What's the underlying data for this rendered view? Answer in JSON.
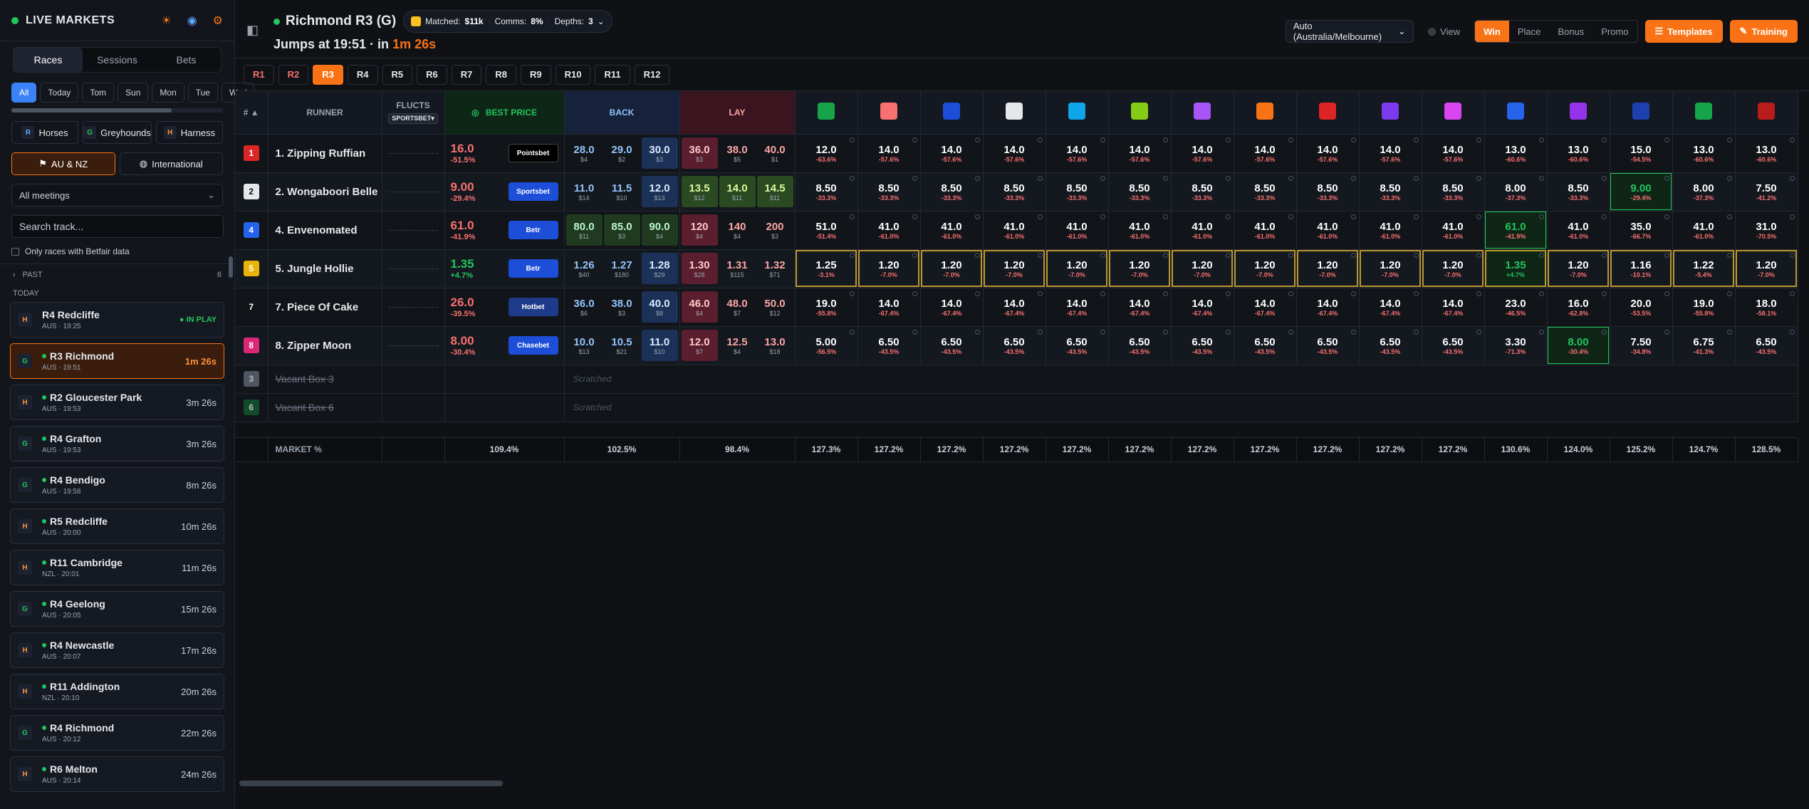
{
  "sidebar": {
    "title": "LIVE MARKETS",
    "tabs": [
      {
        "label": "Races",
        "active": true
      },
      {
        "label": "Sessions"
      },
      {
        "label": "Bets"
      }
    ],
    "days": [
      {
        "label": "All",
        "active": true
      },
      {
        "label": "Today"
      },
      {
        "label": "Tom"
      },
      {
        "label": "Sun"
      },
      {
        "label": "Mon"
      },
      {
        "label": "Tue"
      },
      {
        "label": "Wed"
      }
    ],
    "types": [
      {
        "badge": "R",
        "label": "Horses"
      },
      {
        "badge": "G",
        "label": "Greyhounds"
      },
      {
        "badge": "H",
        "label": "Harness"
      }
    ],
    "regions": [
      {
        "label": "AU & NZ",
        "active": true
      },
      {
        "label": "International"
      }
    ],
    "meetings_select": "All meetings",
    "search_placeholder": "Search track...",
    "betfair_filter": "Only races with Betfair data",
    "past": {
      "label": "PAST",
      "count": "6"
    },
    "today_label": "TODAY",
    "races": [
      {
        "badge": "H",
        "name": "R4 Redcliffe",
        "sub": "AUS · 19:25",
        "time": "● IN PLAY",
        "state": "inplay",
        "dot": false
      },
      {
        "badge": "G",
        "name": "R3 Richmond",
        "sub": "AUS · 19:51",
        "time": "1m 26s",
        "state": "active",
        "dot": true
      },
      {
        "badge": "H",
        "name": "R2 Gloucester Park",
        "sub": "AUS · 19:53",
        "time": "3m 26s",
        "dot": true
      },
      {
        "badge": "G",
        "name": "R4 Grafton",
        "sub": "AUS · 19:53",
        "time": "3m 26s",
        "dot": true
      },
      {
        "badge": "G",
        "name": "R4 Bendigo",
        "sub": "AUS · 19:58",
        "time": "8m 26s",
        "dot": true
      },
      {
        "badge": "H",
        "name": "R5 Redcliffe",
        "sub": "AUS · 20:00",
        "time": "10m 26s",
        "dot": true
      },
      {
        "badge": "H",
        "name": "R11 Cambridge",
        "sub": "NZL · 20:01",
        "time": "11m 26s",
        "dot": true
      },
      {
        "badge": "G",
        "name": "R4 Geelong",
        "sub": "AUS · 20:05",
        "time": "15m 26s",
        "dot": true
      },
      {
        "badge": "H",
        "name": "R4 Newcastle",
        "sub": "AUS · 20:07",
        "time": "17m 26s",
        "dot": true
      },
      {
        "badge": "H",
        "name": "R11 Addington",
        "sub": "NZL · 20:10",
        "time": "20m 26s",
        "dot": true
      },
      {
        "badge": "G",
        "name": "R4 Richmond",
        "sub": "AUS · 20:12",
        "time": "22m 26s",
        "dot": true
      },
      {
        "badge": "H",
        "name": "R6 Melton",
        "sub": "AUS · 20:14",
        "time": "24m 26s",
        "dot": true
      }
    ]
  },
  "header": {
    "title": "Richmond R3 (G)",
    "matched_label": "Matched:",
    "matched": "$11k",
    "comms_label": "Comms:",
    "comms": "8%",
    "depths_label": "Depths:",
    "depths": "3",
    "jumps_prefix": "Jumps at 19:51 · in ",
    "countdown": "1m 26s",
    "timezone": "Auto (Australia/Melbourne)",
    "view_label": "View",
    "markets": [
      {
        "label": "Win",
        "active": true
      },
      {
        "label": "Place"
      },
      {
        "label": "Bonus"
      },
      {
        "label": "Promo"
      }
    ],
    "templates_label": "Templates",
    "training_label": "Training"
  },
  "race_tabs": [
    {
      "label": "R1",
      "state": "done"
    },
    {
      "label": "R2",
      "state": "done"
    },
    {
      "label": "R3",
      "state": "active"
    },
    {
      "label": "R4"
    },
    {
      "label": "R5"
    },
    {
      "label": "R6"
    },
    {
      "label": "R7"
    },
    {
      "label": "R8"
    },
    {
      "label": "R9"
    },
    {
      "label": "R10"
    },
    {
      "label": "R11"
    },
    {
      "label": "R12"
    }
  ],
  "table": {
    "h_num": "# ▲",
    "h_runner": "RUNNER",
    "h_flucts": "FLUCTS",
    "h_flucts_sel": "SPORTSBET▾",
    "h_best": "BEST PRICE",
    "h_back": "BACK",
    "h_lay": "LAY",
    "bookies": [
      {
        "name": "tab",
        "color": "#16a34a"
      },
      {
        "name": "bookie-2",
        "color": "#f87171"
      },
      {
        "name": "bookie-3",
        "color": "#1d4ed8"
      },
      {
        "name": "bookie-4",
        "color": "#e5e7eb"
      },
      {
        "name": "bookie-5",
        "color": "#0ea5e9"
      },
      {
        "name": "bookie-6",
        "color": "#84cc16"
      },
      {
        "name": "bookie-7",
        "color": "#a855f7"
      },
      {
        "name": "bookie-8",
        "color": "#f97316"
      },
      {
        "name": "bookie-9",
        "color": "#dc2626"
      },
      {
        "name": "bookie-10",
        "color": "#7c3aed"
      },
      {
        "name": "bookie-11",
        "color": "#d946ef"
      },
      {
        "name": "bookie-12",
        "color": "#2563eb"
      },
      {
        "name": "bookie-13",
        "color": "#9333ea"
      },
      {
        "name": "bookie-14",
        "color": "#1e40af"
      },
      {
        "name": "bookie-15",
        "color": "#16a34a"
      },
      {
        "name": "bookie-16",
        "color": "#b91c1c"
      }
    ],
    "runners": [
      {
        "num": "1",
        "numColor": "#dc2626",
        "name": "1. Zipping Ruffian",
        "bp": "16.0",
        "bpPct": "-51.5%",
        "bpUp": false,
        "bpBook": "Pointsbet",
        "bpBookColor": "#000",
        "back": [
          [
            "28.0",
            "$4"
          ],
          [
            "29.0",
            "$2"
          ],
          [
            "30.0",
            "$3"
          ]
        ],
        "lay": [
          [
            "36.0",
            "$3"
          ],
          [
            "38.0",
            "$5"
          ],
          [
            "40.0",
            "$1"
          ]
        ],
        "odds": [
          [
            "12.0",
            "-63.6%"
          ],
          [
            "14.0",
            "-57.6%"
          ],
          [
            "14.0",
            "-57.6%"
          ],
          [
            "14.0",
            "-57.6%"
          ],
          [
            "14.0",
            "-57.6%"
          ],
          [
            "14.0",
            "-57.6%"
          ],
          [
            "14.0",
            "-57.6%"
          ],
          [
            "14.0",
            "-57.6%"
          ],
          [
            "14.0",
            "-57.6%"
          ],
          [
            "14.0",
            "-57.6%"
          ],
          [
            "14.0",
            "-57.6%"
          ],
          [
            "13.0",
            "-60.6%"
          ],
          [
            "13.0",
            "-60.6%"
          ],
          [
            "15.0",
            "-54.5%"
          ],
          [
            "13.0",
            "-60.6%"
          ],
          [
            "13.0",
            "-60.6%"
          ]
        ]
      },
      {
        "num": "2",
        "numColor": "#e5e7eb",
        "name": "2. Wongaboori Belle",
        "bp": "9.00",
        "bpPct": "-29.4%",
        "bpUp": false,
        "bpBook": "Sportsbet",
        "bpBookColor": "#1d4ed8",
        "back": [
          [
            "11.0",
            "$14"
          ],
          [
            "11.5",
            "$10"
          ],
          [
            "12.0",
            "$13"
          ]
        ],
        "lay": [
          [
            "13.5",
            "$12"
          ],
          [
            "14.0",
            "$11"
          ],
          [
            "14.5",
            "$11"
          ]
        ],
        "layGreen": true,
        "odds": [
          [
            "8.50",
            "-33.3%"
          ],
          [
            "8.50",
            "-33.3%"
          ],
          [
            "8.50",
            "-33.3%"
          ],
          [
            "8.50",
            "-33.3%"
          ],
          [
            "8.50",
            "-33.3%"
          ],
          [
            "8.50",
            "-33.3%"
          ],
          [
            "8.50",
            "-33.3%"
          ],
          [
            "8.50",
            "-33.3%"
          ],
          [
            "8.50",
            "-33.3%"
          ],
          [
            "8.50",
            "-33.3%"
          ],
          [
            "8.50",
            "-33.3%"
          ],
          [
            "8.00",
            "-37.3%"
          ],
          [
            "8.50",
            "-33.3%"
          ],
          [
            "9.00",
            "-29.4%",
            "best"
          ],
          [
            "8.00",
            "-37.3%"
          ],
          [
            "7.50",
            "-41.2%"
          ]
        ]
      },
      {
        "num": "4",
        "numColor": "#2563eb",
        "name": "4. Envenomated",
        "bp": "61.0",
        "bpPct": "-41.9%",
        "bpUp": false,
        "bpBook": "Betr",
        "bpBookColor": "#1d4ed8",
        "back": [
          [
            "80.0",
            "$11"
          ],
          [
            "85.0",
            "$3"
          ],
          [
            "90.0",
            "$4"
          ]
        ],
        "backGreen": true,
        "lay": [
          [
            "120",
            "$4"
          ],
          [
            "140",
            "$4"
          ],
          [
            "200",
            "$3"
          ]
        ],
        "odds": [
          [
            "51.0",
            "-51.4%"
          ],
          [
            "41.0",
            "-61.0%"
          ],
          [
            "41.0",
            "-61.0%"
          ],
          [
            "41.0",
            "-61.0%"
          ],
          [
            "41.0",
            "-61.0%"
          ],
          [
            "41.0",
            "-61.0%"
          ],
          [
            "41.0",
            "-61.0%"
          ],
          [
            "41.0",
            "-61.0%"
          ],
          [
            "41.0",
            "-61.0%"
          ],
          [
            "41.0",
            "-61.0%"
          ],
          [
            "41.0",
            "-61.0%"
          ],
          [
            "61.0",
            "-41.9%",
            "best"
          ],
          [
            "41.0",
            "-61.0%"
          ],
          [
            "35.0",
            "-66.7%"
          ],
          [
            "41.0",
            "-61.0%"
          ],
          [
            "31.0",
            "-70.5%"
          ]
        ]
      },
      {
        "num": "5",
        "numColor": "#eab308",
        "name": "5. Jungle Hollie",
        "bp": "1.35",
        "bpPct": "+4.7%",
        "bpUp": true,
        "bpBook": "Betr",
        "bpBookColor": "#1d4ed8",
        "hl": true,
        "back": [
          [
            "1.26",
            "$40"
          ],
          [
            "1.27",
            "$180"
          ],
          [
            "1.28",
            "$29"
          ]
        ],
        "lay": [
          [
            "1.30",
            "$28"
          ],
          [
            "1.31",
            "$115"
          ],
          [
            "1.32",
            "$71"
          ]
        ],
        "odds": [
          [
            "1.25",
            "-3.1%"
          ],
          [
            "1.20",
            "-7.0%"
          ],
          [
            "1.20",
            "-7.0%"
          ],
          [
            "1.20",
            "-7.0%"
          ],
          [
            "1.20",
            "-7.0%"
          ],
          [
            "1.20",
            "-7.0%"
          ],
          [
            "1.20",
            "-7.0%"
          ],
          [
            "1.20",
            "-7.0%"
          ],
          [
            "1.20",
            "-7.0%"
          ],
          [
            "1.20",
            "-7.0%"
          ],
          [
            "1.20",
            "-7.0%"
          ],
          [
            "1.35",
            "+4.7%",
            "best"
          ],
          [
            "1.20",
            "-7.0%"
          ],
          [
            "1.16",
            "-10.1%"
          ],
          [
            "1.22",
            "-5.4%"
          ],
          [
            "1.20",
            "-7.0%"
          ]
        ]
      },
      {
        "num": "7",
        "numColor": "#111419",
        "name": "7. Piece Of Cake",
        "bp": "26.0",
        "bpPct": "-39.5%",
        "bpUp": false,
        "bpBook": "Hotbet",
        "bpBookColor": "#1e3a8a",
        "back": [
          [
            "36.0",
            "$6"
          ],
          [
            "38.0",
            "$3"
          ],
          [
            "40.0",
            "$8"
          ]
        ],
        "lay": [
          [
            "46.0",
            "$4"
          ],
          [
            "48.0",
            "$7"
          ],
          [
            "50.0",
            "$12"
          ]
        ],
        "odds": [
          [
            "19.0",
            "-55.8%"
          ],
          [
            "14.0",
            "-67.4%"
          ],
          [
            "14.0",
            "-67.4%"
          ],
          [
            "14.0",
            "-67.4%"
          ],
          [
            "14.0",
            "-67.4%"
          ],
          [
            "14.0",
            "-67.4%"
          ],
          [
            "14.0",
            "-67.4%"
          ],
          [
            "14.0",
            "-67.4%"
          ],
          [
            "14.0",
            "-67.4%"
          ],
          [
            "14.0",
            "-67.4%"
          ],
          [
            "14.0",
            "-67.4%"
          ],
          [
            "23.0",
            "-46.5%"
          ],
          [
            "16.0",
            "-62.8%"
          ],
          [
            "20.0",
            "-53.5%"
          ],
          [
            "19.0",
            "-55.8%"
          ],
          [
            "18.0",
            "-58.1%"
          ]
        ]
      },
      {
        "num": "8",
        "numColor": "#db2777",
        "name": "8. Zipper Moon",
        "bp": "8.00",
        "bpPct": "-30.4%",
        "bpUp": false,
        "bpBook": "Chasebet",
        "bpBookColor": "#1d4ed8",
        "back": [
          [
            "10.0",
            "$13"
          ],
          [
            "10.5",
            "$21"
          ],
          [
            "11.0",
            "$10"
          ]
        ],
        "lay": [
          [
            "12.0",
            "$7"
          ],
          [
            "12.5",
            "$4"
          ],
          [
            "13.0",
            "$18"
          ]
        ],
        "odds": [
          [
            "5.00",
            "-56.5%"
          ],
          [
            "6.50",
            "-43.5%"
          ],
          [
            "6.50",
            "-43.5%"
          ],
          [
            "6.50",
            "-43.5%"
          ],
          [
            "6.50",
            "-43.5%"
          ],
          [
            "6.50",
            "-43.5%"
          ],
          [
            "6.50",
            "-43.5%"
          ],
          [
            "6.50",
            "-43.5%"
          ],
          [
            "6.50",
            "-43.5%"
          ],
          [
            "6.50",
            "-43.5%"
          ],
          [
            "6.50",
            "-43.5%"
          ],
          [
            "3.30",
            "-71.3%"
          ],
          [
            "8.00",
            "-30.4%",
            "best"
          ],
          [
            "7.50",
            "-34.8%"
          ],
          [
            "6.75",
            "-41.3%"
          ],
          [
            "6.50",
            "-43.5%"
          ]
        ]
      }
    ],
    "scratched": [
      {
        "num": "3",
        "numColor": "#6b7280",
        "name": "Vacant Box 3",
        "label": "Scratched"
      },
      {
        "num": "6",
        "numColor": "#166534",
        "name": "Vacant Box 6",
        "label": "Scratched"
      }
    ],
    "market_label": "MARKET %",
    "market_best": "109.4%",
    "market_back": "102.5%",
    "market_lay": "98.4%",
    "market_bookies": [
      "127.3%",
      "127.2%",
      "127.2%",
      "127.2%",
      "127.2%",
      "127.2%",
      "127.2%",
      "127.2%",
      "127.2%",
      "127.2%",
      "127.2%",
      "130.6%",
      "124.0%",
      "125.2%",
      "124.7%",
      "128.5%"
    ]
  }
}
